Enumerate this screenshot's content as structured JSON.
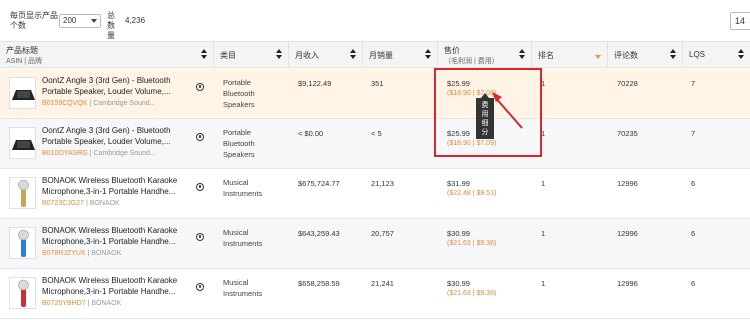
{
  "toolbar": {
    "per_page_label": "每页显示产品个数",
    "per_page_value": "200",
    "total_label": "总数量",
    "total_value": "4,236",
    "page_number": "14"
  },
  "columns": {
    "title": "产品标题",
    "title_sub": "ASIN | 品牌",
    "category": "类目",
    "revenue": "月收入",
    "sales": "月销量",
    "price": "售价",
    "price_sub": "（毛利润 | 费用）",
    "rank": "排名",
    "reviews": "评论数",
    "lqs": "LQS"
  },
  "tooltip": "费用细分",
  "rows": [
    {
      "title1": "OontZ Angle 3 (3rd Gen) - Bluetooth",
      "title2": "Portable Speaker, Louder Volume,...",
      "asin": "B0159CQVQK",
      "brand": "Cambridge Sound...",
      "cat1": "Portable",
      "cat2": "Bluetooth",
      "cat3": "Speakers",
      "revenue": "$9,122.49",
      "sales": "351",
      "price": "$25.99",
      "fee": "($18.90 | $7.09)",
      "rank": "1",
      "reviews": "70228",
      "lqs": "7"
    },
    {
      "title1": "OontZ Angle 3 (3rd Gen) - Bluetooth",
      "title2": "Portable Speaker, Louder Volume,...",
      "asin": "B010OYASRG",
      "brand": "Cambridge Sound...",
      "cat1": "Portable",
      "cat2": "Bluetooth",
      "cat3": "Speakers",
      "revenue": "< $0.00",
      "sales": "< 5",
      "price": "$25.99",
      "fee": "($18.90 | $7.09)",
      "rank": "1",
      "reviews": "70235",
      "lqs": "7"
    },
    {
      "title1": "BONAOK Wireless Bluetooth Karaoke",
      "title2": "Microphone,3-in-1 Portable Handhe...",
      "asin": "B0723CJG27",
      "brand": "BONAOK",
      "cat1": "Musical",
      "cat2": "Instruments",
      "cat3": "",
      "revenue": "$675,724.77",
      "sales": "21,123",
      "price": "$31.99",
      "fee": "($22.48 | $9.51)",
      "rank": "1",
      "reviews": "12996",
      "lqs": "6"
    },
    {
      "title1": "BONAOK Wireless Bluetooth Karaoke",
      "title2": "Microphone,3-in-1 Portable Handhe...",
      "asin": "B078RJZYUX",
      "brand": "BONAOK",
      "cat1": "Musical",
      "cat2": "Instruments",
      "cat3": "",
      "revenue": "$643,259.43",
      "sales": "20,757",
      "price": "$30.99",
      "fee": "($21.63 | $9.36)",
      "rank": "1",
      "reviews": "12996",
      "lqs": "6"
    },
    {
      "title1": "BONAOK Wireless Bluetooth Karaoke",
      "title2": "Microphone,3-in-1 Portable Handhe...",
      "asin": "B0725YBHD7",
      "brand": "BONAOK",
      "cat1": "Musical",
      "cat2": "Instruments",
      "cat3": "",
      "revenue": "$658,258.59",
      "sales": "21,241",
      "price": "$30.99",
      "fee": "($21.63 | $9.36)",
      "rank": "1",
      "reviews": "12996",
      "lqs": "6"
    }
  ],
  "colors": {
    "accent": "#e88a3a",
    "highlight_box": "#d9262f",
    "highlight_row": "#fff4e6"
  },
  "icons": {
    "row_action": "circle-person-icon",
    "sort": "sort-arrows-icon"
  }
}
